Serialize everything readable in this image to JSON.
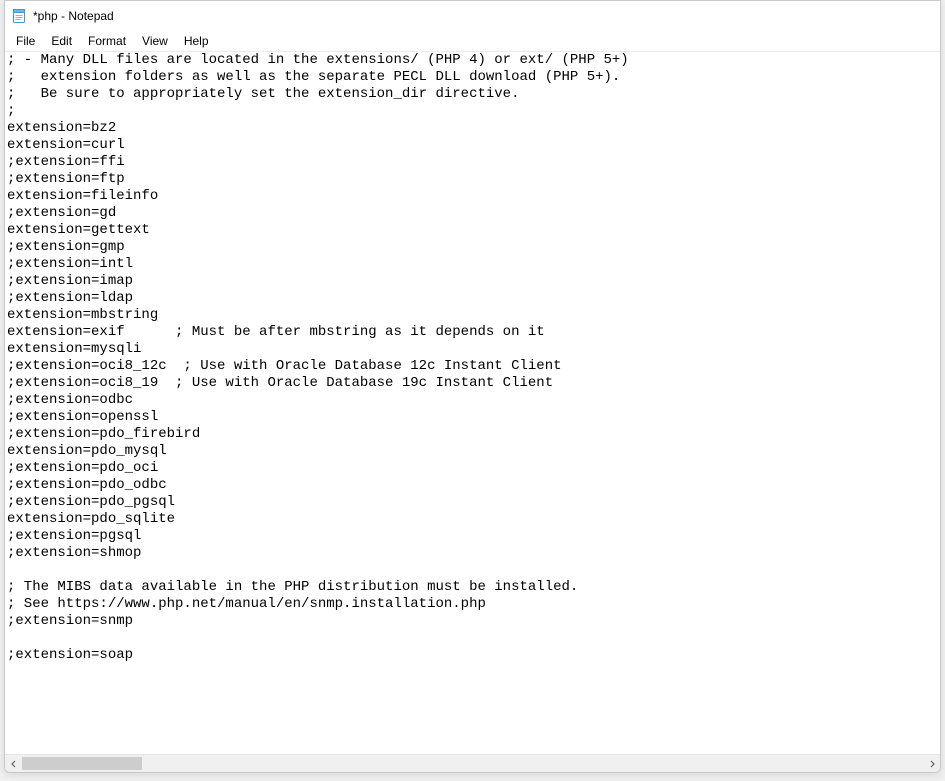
{
  "window": {
    "title": "*php - Notepad"
  },
  "menu": {
    "file": "File",
    "edit": "Edit",
    "format": "Format",
    "view": "View",
    "help": "Help"
  },
  "editor": {
    "lines": [
      "; - Many DLL files are located in the extensions/ (PHP 4) or ext/ (PHP 5+)",
      ";   extension folders as well as the separate PECL DLL download (PHP 5+).",
      ";   Be sure to appropriately set the extension_dir directive.",
      ";",
      "extension=bz2",
      "extension=curl",
      ";extension=ffi",
      ";extension=ftp",
      "extension=fileinfo",
      ";extension=gd",
      "extension=gettext",
      ";extension=gmp",
      ";extension=intl",
      ";extension=imap",
      ";extension=ldap",
      "extension=mbstring",
      "extension=exif      ; Must be after mbstring as it depends on it",
      "extension=mysqli",
      ";extension=oci8_12c  ; Use with Oracle Database 12c Instant Client",
      ";extension=oci8_19  ; Use with Oracle Database 19c Instant Client",
      ";extension=odbc",
      ";extension=openssl",
      ";extension=pdo_firebird",
      "extension=pdo_mysql",
      ";extension=pdo_oci",
      ";extension=pdo_odbc",
      ";extension=pdo_pgsql",
      "extension=pdo_sqlite",
      ";extension=pgsql",
      ";extension=shmop",
      "",
      "; The MIBS data available in the PHP distribution must be installed.",
      "; See https://www.php.net/manual/en/snmp.installation.php",
      ";extension=snmp",
      "",
      ";extension=soap"
    ]
  }
}
